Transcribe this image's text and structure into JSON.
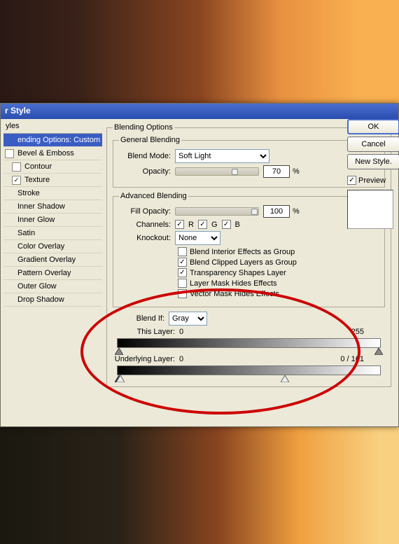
{
  "title": "r Style",
  "sidebar": {
    "header": "yles",
    "items": [
      {
        "label": "ending Options: Custom",
        "checked": false,
        "selected": true,
        "hascb": false
      },
      {
        "label": "Bevel & Emboss",
        "checked": false,
        "selected": false,
        "hascb": true
      },
      {
        "label": "Contour",
        "checked": false,
        "selected": false,
        "hascb": true,
        "indent": true
      },
      {
        "label": "Texture",
        "checked": true,
        "selected": false,
        "hascb": true,
        "indent": true
      },
      {
        "label": "Stroke",
        "checked": false,
        "selected": false,
        "hascb": false
      },
      {
        "label": "Inner Shadow",
        "checked": false,
        "selected": false,
        "hascb": false
      },
      {
        "label": "Inner Glow",
        "checked": false,
        "selected": false,
        "hascb": false
      },
      {
        "label": "Satin",
        "checked": false,
        "selected": false,
        "hascb": false
      },
      {
        "label": "Color Overlay",
        "checked": false,
        "selected": false,
        "hascb": false
      },
      {
        "label": "Gradient Overlay",
        "checked": false,
        "selected": false,
        "hascb": false
      },
      {
        "label": "Pattern Overlay",
        "checked": false,
        "selected": false,
        "hascb": false
      },
      {
        "label": "Outer Glow",
        "checked": false,
        "selected": false,
        "hascb": false
      },
      {
        "label": "Drop Shadow",
        "checked": false,
        "selected": false,
        "hascb": false
      }
    ]
  },
  "main": {
    "blending_options_label": "Blending Options",
    "general_blending_label": "General Blending",
    "blend_mode_label": "Blend Mode:",
    "blend_mode_value": "Soft Light",
    "opacity_label": "Opacity:",
    "opacity_value": "70",
    "pct": "%",
    "advanced_blending_label": "Advanced Blending",
    "fill_opacity_label": "Fill Opacity:",
    "fill_opacity_value": "100",
    "channels_label": "Channels:",
    "channel_r": "R",
    "channel_g": "G",
    "channel_b": "B",
    "knockout_label": "Knockout:",
    "knockout_value": "None",
    "opt1": "Blend Interior Effects as Group",
    "opt2": "Blend Clipped Layers as Group",
    "opt3": "Transparency Shapes Layer",
    "opt4": "Layer Mask Hides Effects",
    "opt5": "Vector Mask Hides Effects",
    "opt1_checked": false,
    "opt2_checked": true,
    "opt3_checked": true,
    "opt4_checked": false,
    "opt5_checked": false,
    "blend_if_label": "Blend If:",
    "blend_if_value": "Gray",
    "this_layer_label": "This Layer:",
    "this_layer_black": "0",
    "this_layer_white": "255",
    "underlying_label": "Underlying Layer:",
    "underlying_black": "0",
    "underlying_white": "0   /   161"
  },
  "buttons": {
    "ok": "OK",
    "cancel": "Cancel",
    "new_style": "New Style.",
    "preview": "Preview"
  }
}
